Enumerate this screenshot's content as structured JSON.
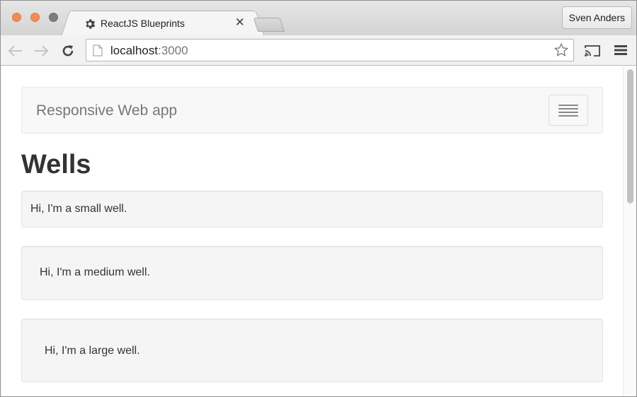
{
  "browser": {
    "tab": {
      "title": "ReactJS Blueprints",
      "close_glyph": "✕",
      "favicon": "gear-icon"
    },
    "profile_name": "Sven Anders",
    "address_bar": {
      "host": "localhost",
      "port_path": ":3000"
    },
    "icons": {
      "back": "back-arrow-icon",
      "forward": "forward-arrow-icon",
      "reload": "reload-icon",
      "bookmark": "star-icon",
      "cast": "cast-icon",
      "menu": "hamburger-menu-icon"
    }
  },
  "page": {
    "navbar": {
      "brand": "Responsive Web app",
      "toggle_icon": "hamburger-icon"
    },
    "heading": "Wells",
    "wells": {
      "small": "Hi, I'm a small well.",
      "medium": "Hi, I'm a medium well.",
      "large": "Hi, I'm a large well."
    }
  },
  "colors": {
    "traffic_light_active": "#f18c57",
    "traffic_light_inactive": "#7d7d7d",
    "navbar_bg": "#f8f8f8",
    "well_bg": "#f5f5f5",
    "heading_text": "#333333",
    "brand_text": "#777777"
  }
}
